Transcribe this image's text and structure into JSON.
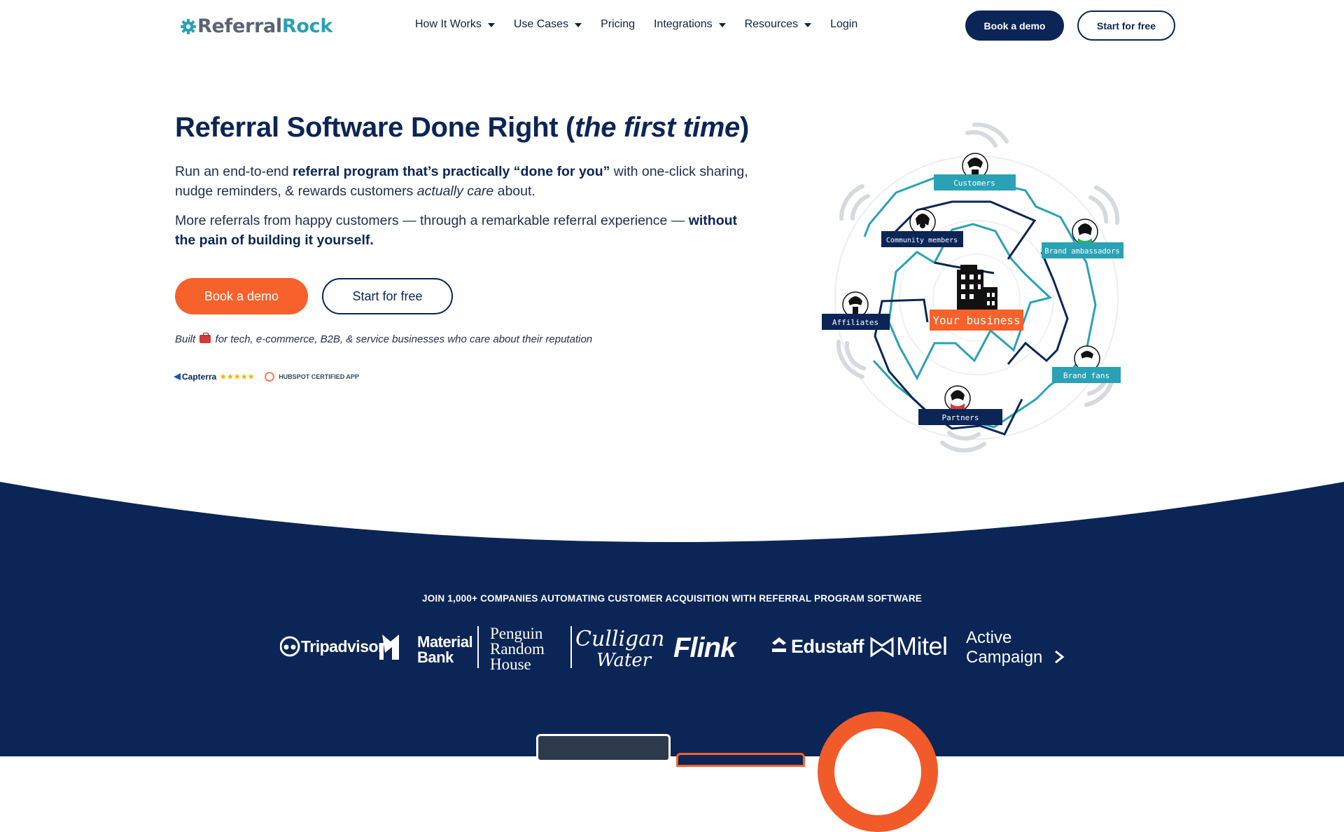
{
  "nav": {
    "logo_part1": "Referral",
    "logo_part2": "Rock",
    "items": [
      {
        "label": "How It Works",
        "dropdown": true
      },
      {
        "label": "Use Cases",
        "dropdown": true
      },
      {
        "label": "Pricing",
        "dropdown": false
      },
      {
        "label": "Integrations",
        "dropdown": true
      },
      {
        "label": "Resources",
        "dropdown": true
      },
      {
        "label": "Login",
        "dropdown": false
      }
    ],
    "book_demo": "Book a demo",
    "start_free": "Start for free"
  },
  "hero": {
    "title_main": "Referral Software Done Right (",
    "title_italic": "the first time",
    "title_end": ")",
    "p1_a": "Run an end-to-end ",
    "p1_b": "referral program that’s practically “done for you”",
    "p1_c": " with one-click sharing, nudge reminders, & rewards customers ",
    "p1_d": "actually care",
    "p1_e": " about.",
    "p2_a": "More referrals from happy customers — through a remarkable referral experience — ",
    "p2_b": "without the pain of building it yourself.",
    "book_demo": "Book a demo",
    "start_free": "Start for free",
    "built_a": "Built",
    "built_b": "for tech, e-commerce, B2B, & service businesses who care about their reputation",
    "capterra": "Capterra",
    "capterra_stars": "★★★★★",
    "hubspot": "HUBSPOT CERTIFIED APP"
  },
  "illustration": {
    "center": "Your business",
    "labels": [
      "Customers",
      "Community members",
      "Brand ambassadors",
      "Affiliates",
      "Brand fans",
      "Partners"
    ]
  },
  "social_proof": {
    "heading": "JOIN 1,000+ COMPANIES AUTOMATING CUSTOMER ACQUISITION WITH REFERRAL PROGRAM SOFTWARE",
    "logos": [
      "Tripadvisor",
      "Material",
      "Bank",
      "Penguin",
      "Random",
      "House",
      "Culligan",
      "Water",
      "Flink",
      "Edustaff",
      "Mitel",
      "Active",
      "Campaign"
    ]
  },
  "colors": {
    "navy": "#0b2556",
    "orange": "#f7612b",
    "teal": "#2aa1b4"
  }
}
